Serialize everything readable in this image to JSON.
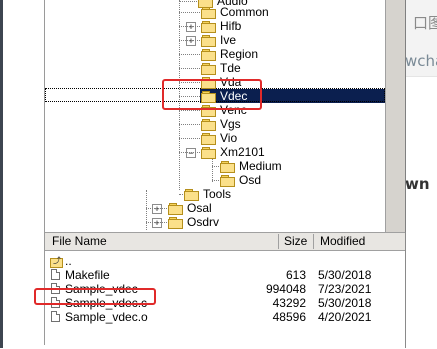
{
  "tree": {
    "nodes": [
      {
        "label": "Audio",
        "expander": ""
      },
      {
        "label": "Common",
        "expander": ""
      },
      {
        "label": "Hifb",
        "expander": "+"
      },
      {
        "label": "Ive",
        "expander": "+"
      },
      {
        "label": "Region",
        "expander": ""
      },
      {
        "label": "Tde",
        "expander": ""
      },
      {
        "label": "Vda",
        "expander": ""
      },
      {
        "label": "Vdec",
        "expander": "",
        "selected": true
      },
      {
        "label": "Venc",
        "expander": ""
      },
      {
        "label": "Vgs",
        "expander": ""
      },
      {
        "label": "Vio",
        "expander": ""
      },
      {
        "label": "Xm2101",
        "expander": "−"
      },
      {
        "label": "Medium",
        "expander": ""
      },
      {
        "label": "Osd",
        "expander": ""
      },
      {
        "label": "Tools",
        "expander": ""
      },
      {
        "label": "Osal",
        "expander": "+"
      },
      {
        "label": "Osdrv",
        "expander": "+"
      }
    ]
  },
  "file_list": {
    "headers": {
      "name": "File Name",
      "size": "Size",
      "modified": "Modified"
    },
    "rows": [
      {
        "name": "..",
        "size": "",
        "modified": "",
        "icon": "up-folder-icon"
      },
      {
        "name": "Makefile",
        "size": "613",
        "modified": "5/30/2018",
        "icon": "file-icon"
      },
      {
        "name": "Sample_vdec",
        "size": "994048",
        "modified": "7/23/2021",
        "icon": "file-icon"
      },
      {
        "name": "Sample_vdec.c",
        "size": "43292",
        "modified": "5/30/2018",
        "icon": "file-icon"
      },
      {
        "name": "Sample_vdec.o",
        "size": "48596",
        "modified": "4/20/2021",
        "icon": "file-icon"
      }
    ]
  },
  "right_panel": {
    "text1": "口图",
    "text2": "wcha",
    "text3": "wn"
  },
  "colors": {
    "selection": "#0b1f4f",
    "highlight_box": "#e02a2a",
    "folder": "#fbe08a"
  }
}
